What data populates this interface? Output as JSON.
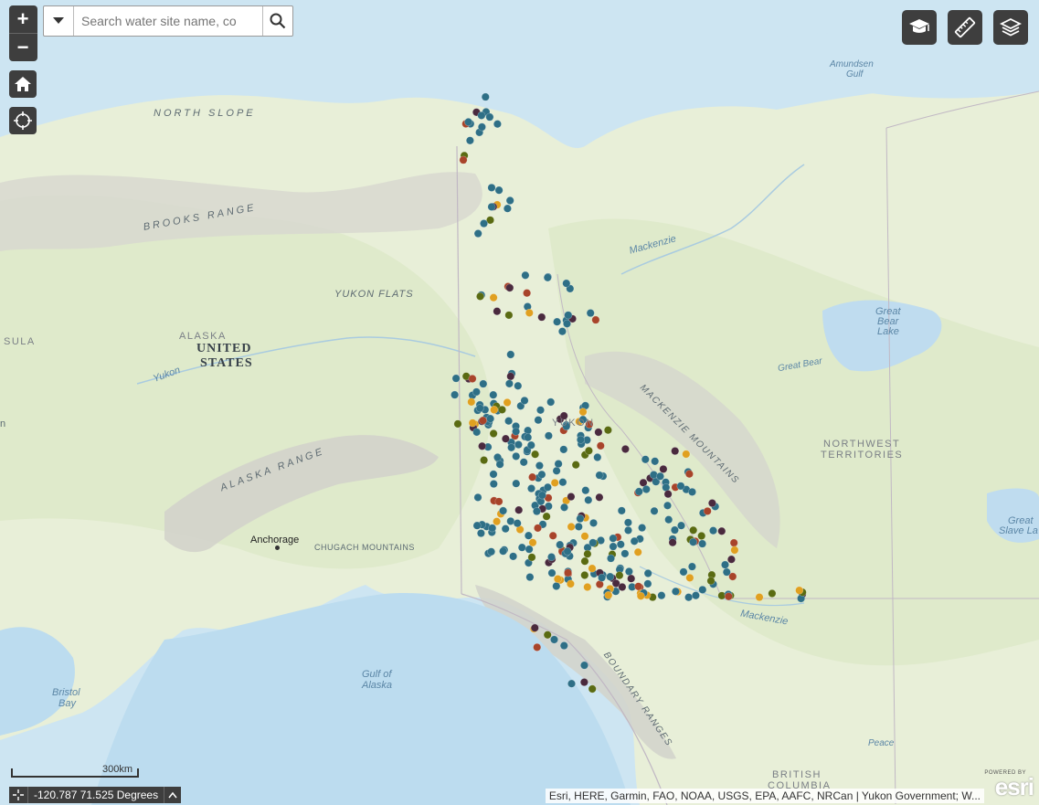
{
  "search": {
    "placeholder": "Search water site name, co"
  },
  "map": {
    "labels": {
      "north_slope": "NORTH SLOPE",
      "brooks_range": "BROOKS RANGE",
      "yukon_flats": "YUKON FLATS",
      "alaska": "ALASKA",
      "united_states": "UNITED",
      "united_states_2": "STATES",
      "yukon_river": "Yukon",
      "yukon_territory": "YUKON",
      "alaska_range": "ALASKA RANGE",
      "anchorage": "Anchorage",
      "chugach": "CHUGACH MOUNTAINS",
      "gulf_of_alaska": "Gulf of",
      "gulf_of_alaska_2": "Alaska",
      "bristol_bay": "Bristol",
      "bristol_bay_2": "Bay",
      "mackenzie_1": "Mackenzie",
      "mackenzie_2": "Mackenzie",
      "mackenzie_mountains": "MACKENZIE MOUNTAINS",
      "boundary_ranges": "BOUNDARY RANGES",
      "great_bear_lake": "Great",
      "great_bear_lake_2": "Bear",
      "great_bear_lake_3": "Lake",
      "great_bear_river": "Great Bear",
      "nwt": "NORTHWEST",
      "nwt_2": "TERRITORIES",
      "great_slave": "Great",
      "great_slave_2": "Slave La",
      "amundsen": "Amundsen",
      "amundsen_2": "Gulf",
      "peace": "Peace",
      "bc": "BRITISH",
      "bc_2": "COLUMBIA",
      "peninsula": "SULA",
      "edge_n": "n"
    },
    "site_colors": {
      "teal": "#2e6f86",
      "olive": "#5a6b12",
      "gold": "#e0a020",
      "plum": "#4a2a3e",
      "rust": "#a8442a"
    }
  },
  "controls": {
    "zoom_in": "+",
    "zoom_out": "−",
    "home_icon": "home-icon",
    "locate_icon": "locate-icon",
    "tools": [
      "education-icon",
      "measure-icon",
      "layers-icon"
    ]
  },
  "scale": {
    "label": "300km"
  },
  "coords": {
    "text": "-120.787 71.525 Degrees"
  },
  "attribution": {
    "text": "Esri, HERE, Garmin, FAO, NOAA, USGS, EPA, AAFC, NRCan | Yukon Government; W..."
  },
  "logo": {
    "text": "esri",
    "powered": "POWERED BY"
  }
}
